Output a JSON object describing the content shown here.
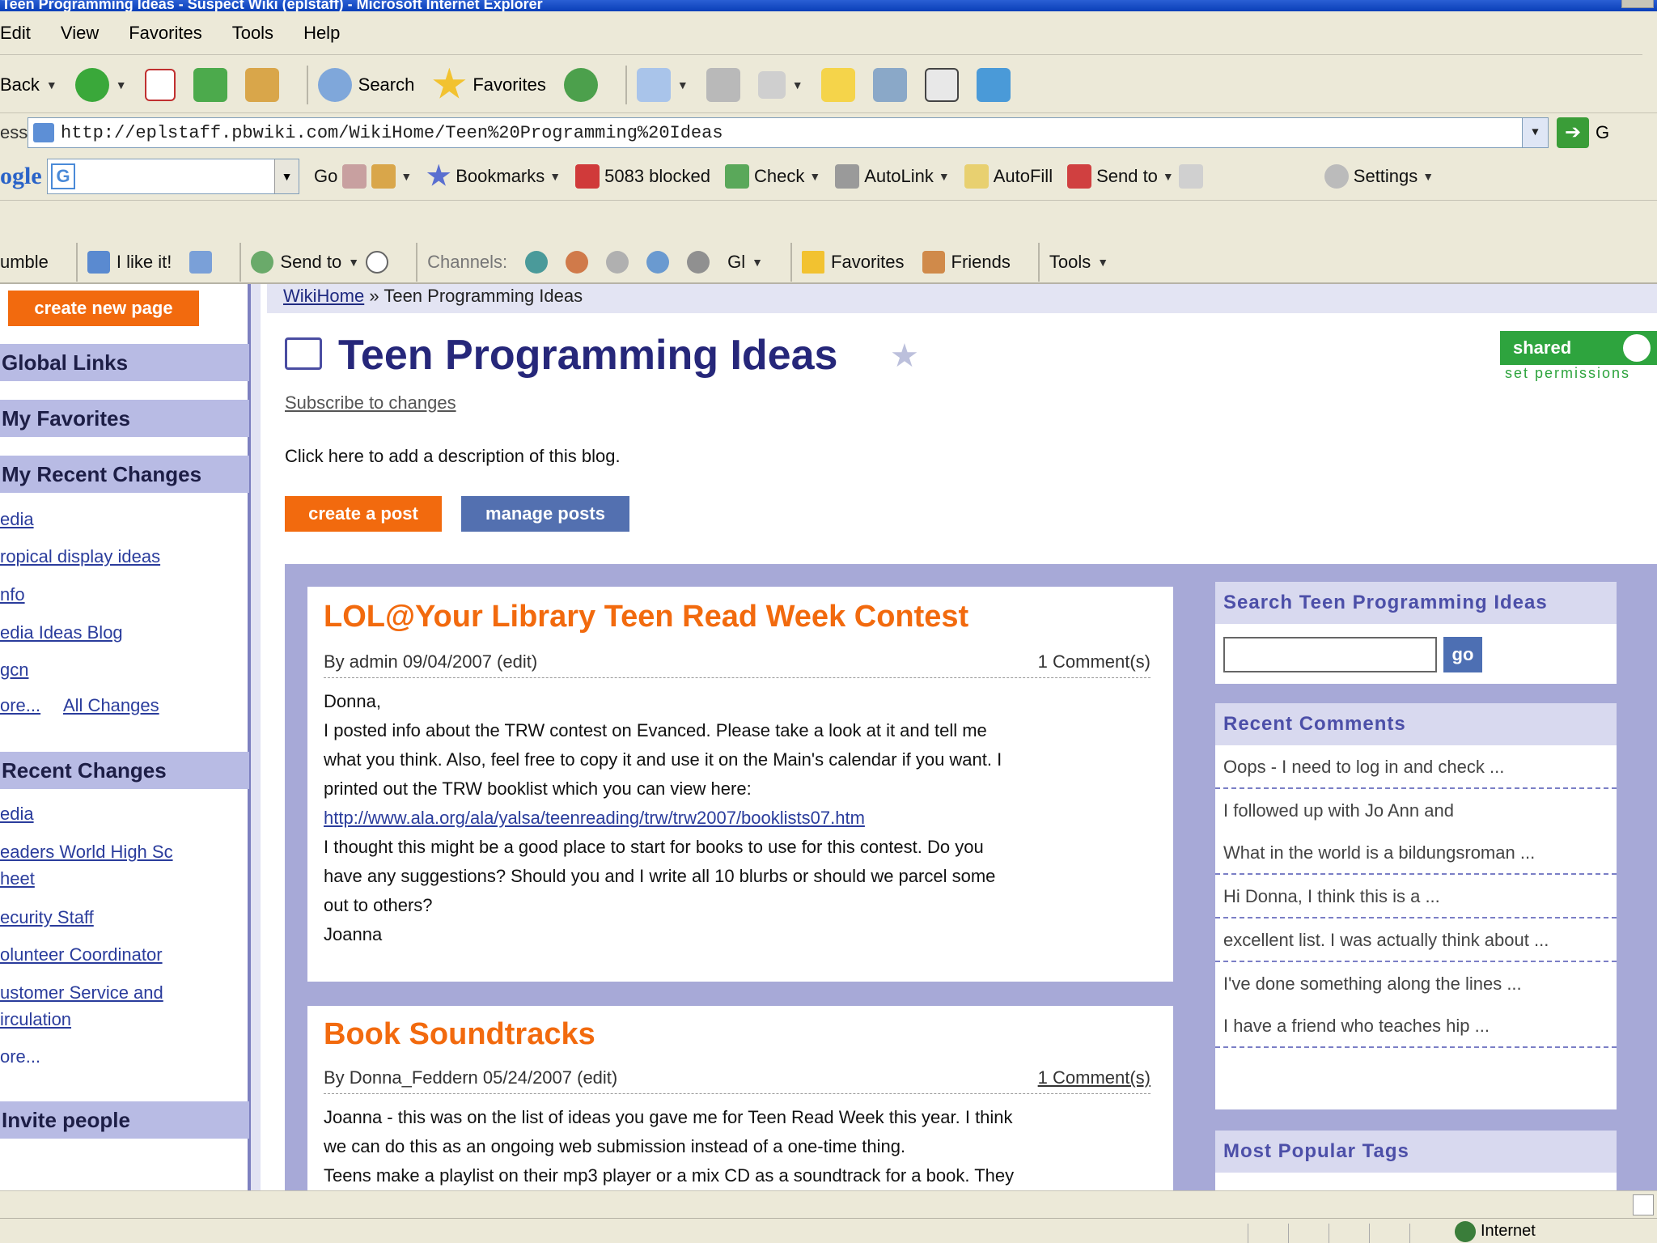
{
  "window": {
    "title": "Teen Programming Ideas - Suspect Wiki (eplstaff) - Microsoft Internet Explorer"
  },
  "menubar": [
    "Edit",
    "View",
    "Favorites",
    "Tools",
    "Help"
  ],
  "toolbar": {
    "back_label": "Back",
    "search_label": "Search",
    "favorites_label": "Favorites"
  },
  "address": {
    "label": "ess",
    "url": "http://eplstaff.pbwiki.com/WikiHome/Teen%20Programming%20Ideas",
    "go_label": "G"
  },
  "google_toolbar": {
    "logo": "ogle",
    "go_label": "Go",
    "bookmarks_label": "Bookmarks",
    "blocked_label": "5083 blocked",
    "check_label": "Check",
    "autolink_label": "AutoLink",
    "autofill_label": "AutoFill",
    "sendto_label": "Send to",
    "settings_label": "Settings"
  },
  "stumble_toolbar": {
    "stumble_label": "umble",
    "like_label": "I like it!",
    "sendto_label": "Send to",
    "channels_label": "Channels:",
    "favorites_label": "Favorites",
    "friends_label": "Friends",
    "tools_label": "Tools"
  },
  "sidebar": {
    "create_page_label": "create new page",
    "global_links_label": "Global Links",
    "my_favorites_label": "My Favorites",
    "my_recent_changes_label": "My Recent Changes",
    "my_recent_items": [
      "edia",
      "ropical display ideas",
      "nfo",
      "edia Ideas Blog",
      "gcn"
    ],
    "more_label": "ore...",
    "all_changes_label": "All Changes",
    "recent_changes_label": "Recent Changes",
    "recent_items": [
      "edia",
      "eaders World High Sc",
      "heet",
      "ecurity Staff",
      "olunteer Coordinator",
      "ustomer Service and",
      "irculation"
    ],
    "recent_more_label": "ore...",
    "invite_label": "Invite people"
  },
  "main": {
    "breadcrumb_home": "WikiHome",
    "breadcrumb_sep": "»",
    "breadcrumb_current": "Teen Programming Ideas",
    "title": "Teen Programming Ideas",
    "subscribe_label": "Subscribe to changes",
    "description": "Click here to add a description of this blog.",
    "create_post_label": "create a post",
    "manage_posts_label": "manage posts",
    "shared_label": "shared",
    "permissions_label": "set permissions"
  },
  "posts": [
    {
      "title": "LOL@Your Library Teen Read Week Contest",
      "meta": "By admin 09/04/2007 (edit)",
      "comments": "1 Comment(s)",
      "body": [
        "Donna,",
        "I posted info about the TRW contest on Evanced. Please take a look at it and tell me",
        "what you think. Also, feel free to copy it and use it on the Main's calendar if you want. I",
        "printed out the TRW booklist which you can view here:",
        "http://www.ala.org/ala/yalsa/teenreading/trw/trw2007/booklists07.htm",
        "I thought this might be a good place to start for books to use for this contest. Do you",
        "have any suggestions? Should you and I write all 10 blurbs or should we parcel some",
        "out to others?",
        "Joanna"
      ]
    },
    {
      "title": "Book Soundtracks",
      "meta": "By Donna_Feddern 05/24/2007 (edit)",
      "comments": "1 Comment(s)",
      "body": [
        "Joanna - this was on the list of ideas you gave me for Teen Read Week this year. I think",
        "we can do this as an ongoing web submission instead of a one-time thing.",
        "Teens make a playlist on their mp3 player or a mix CD as a soundtrack for a book. They"
      ]
    }
  ],
  "right": {
    "search_head": "Search Teen Programming Ideas",
    "search_go": "go",
    "recent_comments_head": "Recent Comments",
    "recent_comments": [
      "Oops - I need to log in and check ...",
      "I followed up with Jo Ann and",
      "What in the world is a bildungsroman ...",
      "Hi Donna, I think this is a ...",
      "excellent list. I was actually think about ...",
      "I've done something along the lines ...",
      "I have a friend who teaches hip ..."
    ],
    "popular_tags_head": "Most Popular Tags"
  },
  "statusbar": {
    "zone_label": "Internet"
  },
  "colors": {
    "orange": "#f26a0e",
    "navy_title": "#26277a",
    "lavender": "#a7a9d7",
    "shared_green": "#2ea43e"
  }
}
